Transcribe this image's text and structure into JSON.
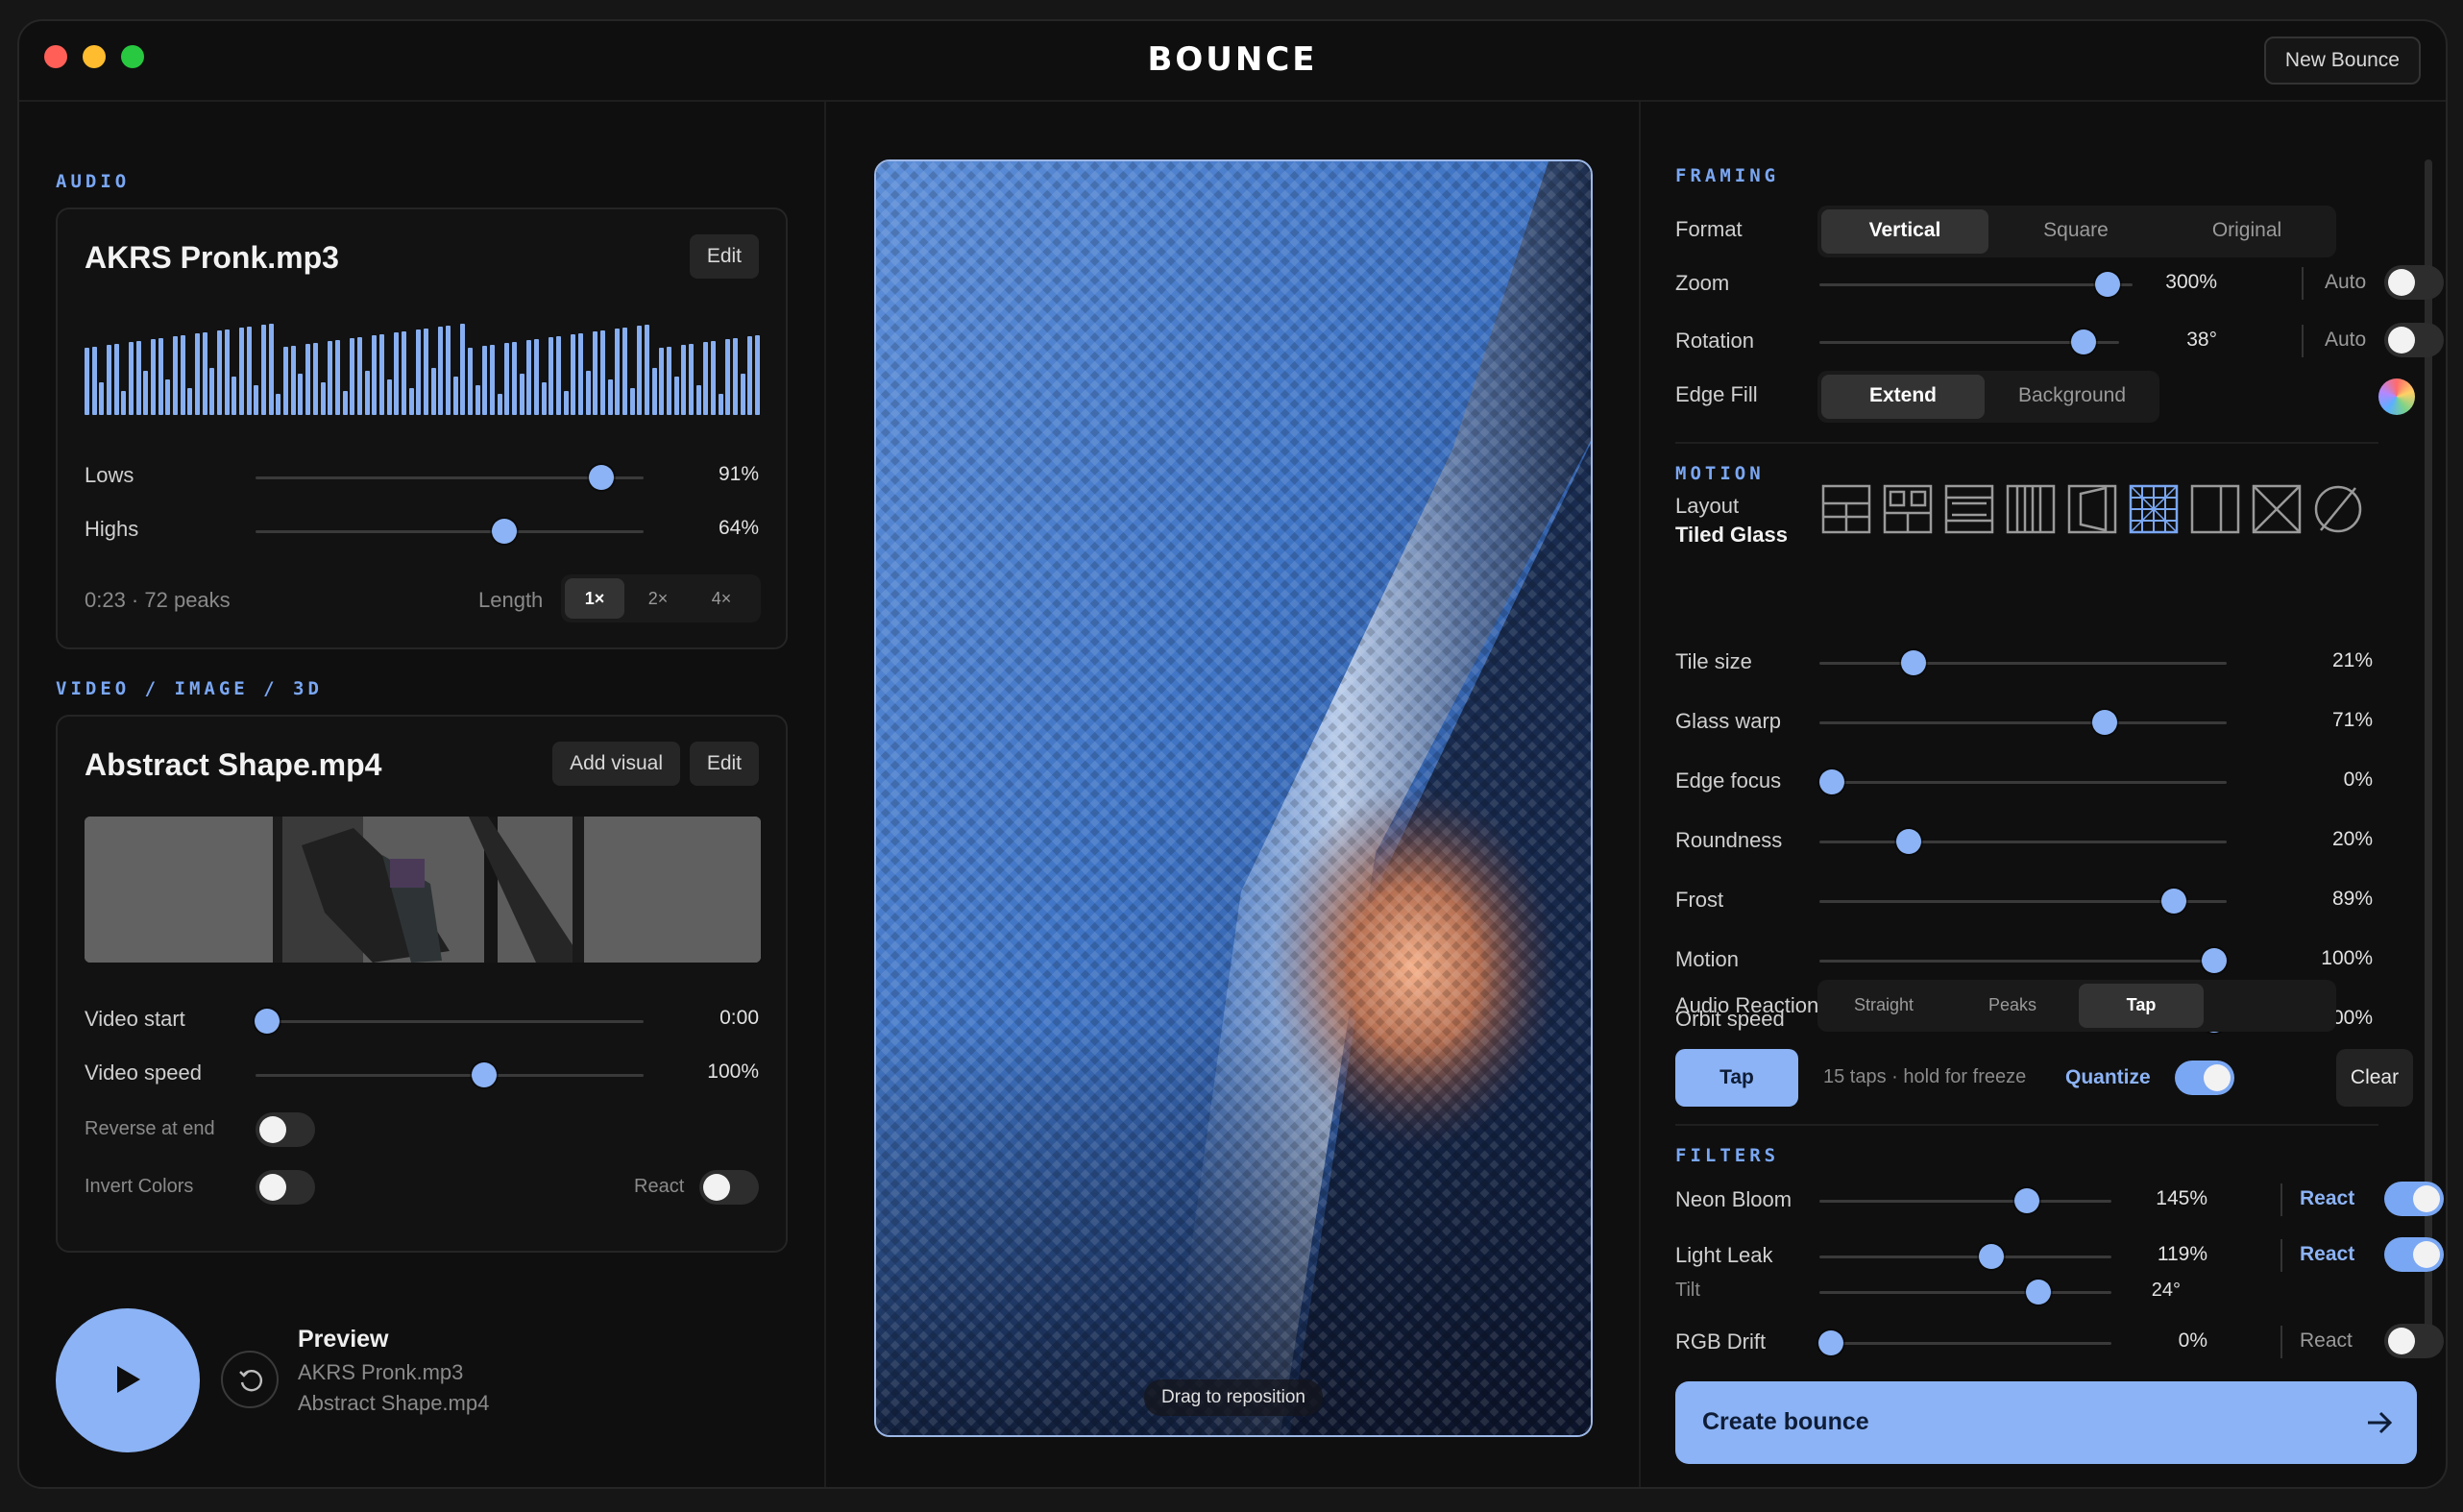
{
  "app": {
    "logo_text": "BOUNCE",
    "new_bounce_label": "New Bounce"
  },
  "audio": {
    "section_title": "AUDIO",
    "file_name": "AKRS Pronk.mp3",
    "edit_label": "Edit",
    "lows_label": "Lows",
    "lows_value": "91%",
    "lows_level": 0.91,
    "highs_label": "Highs",
    "highs_value": "64%",
    "highs_level": 0.64,
    "meta": "0:23 · 72 peaks",
    "length_label": "Length",
    "length_options": [
      "1×",
      "2×",
      "4×"
    ],
    "length_selected": "1×"
  },
  "video": {
    "section_title": "VIDEO / IMAGE / 3D",
    "file_name": "Abstract Shape.mp4",
    "add_visual_label": "Add visual",
    "edit_label": "Edit",
    "start_label": "Video start",
    "start_value": "0:00",
    "start_level": 0.0,
    "speed_label": "Video speed",
    "speed_value": "100%",
    "speed_level": 0.59,
    "reverse_label": "Reverse at end",
    "reverse_on": false,
    "invert_label": "Invert Colors",
    "invert_on": false,
    "react_label": "React",
    "react_on": false
  },
  "preview": {
    "title": "Preview",
    "audio_name": "AKRS Pronk.mp3",
    "video_name": "Abstract Shape.mp4",
    "drag_hint": "Drag to reposition"
  },
  "framing": {
    "section_title": "FRAMING",
    "format_label": "Format",
    "format_options": [
      "Vertical",
      "Square",
      "Original"
    ],
    "format_selected": "Vertical",
    "zoom_label": "Zoom",
    "zoom_value": "300%",
    "zoom_level": 0.92,
    "zoom_auto_label": "Auto",
    "zoom_auto_on": false,
    "rotation_label": "Rotation",
    "rotation_value": "38°",
    "rotation_level": 0.88,
    "rotation_auto_label": "Auto",
    "rotation_auto_on": false,
    "edge_fill_label": "Edge Fill",
    "edge_fill_options": [
      "Extend",
      "Background"
    ],
    "edge_fill_selected": "Extend"
  },
  "motion": {
    "section_title": "MOTION",
    "layout_label": "Layout",
    "layout_value": "Tiled Glass",
    "layout_icons": [
      "grid-split-icon",
      "grid-blocks-icon",
      "rows-icon",
      "columns-icon",
      "perspective-panel-icon",
      "tiled-glass-icon",
      "split-panel-icon",
      "x-cross-icon",
      "none-slash-icon"
    ],
    "layout_selected_index": 5,
    "sliders": [
      {
        "label": "Tile size",
        "value": "21%",
        "level": 0.23
      },
      {
        "label": "Glass warp",
        "value": "71%",
        "level": 0.7
      },
      {
        "label": "Edge focus",
        "value": "0%",
        "level": 0.03
      },
      {
        "label": "Roundness",
        "value": "20%",
        "level": 0.22
      },
      {
        "label": "Frost",
        "value": "89%",
        "level": 0.87
      },
      {
        "label": "Motion",
        "value": "100%",
        "level": 0.97
      },
      {
        "label": "Orbit speed",
        "value": "100%",
        "level": 0.97
      }
    ],
    "audio_reaction_label": "Audio Reaction",
    "audio_reaction_options": [
      "Straight",
      "Peaks",
      "Tap"
    ],
    "audio_reaction_selected": "Tap",
    "tap_label": "Tap",
    "tap_status": "15 taps · hold for freeze",
    "quantize_label": "Quantize",
    "quantize_on": true,
    "clear_label": "Clear"
  },
  "filters": {
    "section_title": "FILTERS",
    "neon_label": "Neon Bloom",
    "neon_value": "145%",
    "neon_level": 0.71,
    "neon_react_label": "React",
    "neon_react_on": true,
    "leak_label": "Light Leak",
    "leak_value": "119%",
    "leak_level": 0.59,
    "leak_react_label": "React",
    "leak_react_on": true,
    "tilt_label": "Tilt",
    "tilt_value": "24°",
    "tilt_level": 0.75,
    "rgb_label": "RGB Drift",
    "rgb_value": "0%",
    "rgb_level": 0.04,
    "rgb_react_label": "React",
    "rgb_react_on": false
  },
  "create_label": "Create bounce",
  "colors": {
    "accent": "#8cb3f5",
    "section_title": "#7aa7f3",
    "background": "#0f0f0f"
  }
}
